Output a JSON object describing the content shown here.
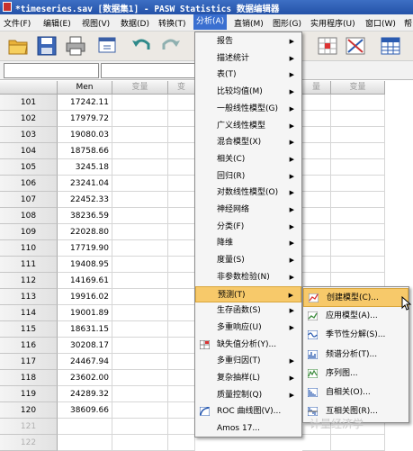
{
  "window": {
    "title": "*timeseries.sav [数据集1] - PASW Statistics 数据编辑器"
  },
  "menubar": [
    "文件(F)",
    "编辑(E)",
    "视图(V)",
    "数据(D)",
    "转换(T)",
    "分析(A)",
    "直销(M)",
    "图形(G)",
    "实用程序(U)",
    "窗口(W)",
    "帮"
  ],
  "grid": {
    "columns": [
      "Men",
      "变量",
      "变",
      "量",
      "变量"
    ],
    "rows": [
      {
        "num": "101",
        "men": "17242.11"
      },
      {
        "num": "102",
        "men": "17979.72"
      },
      {
        "num": "103",
        "men": "19080.03"
      },
      {
        "num": "104",
        "men": "18758.66"
      },
      {
        "num": "105",
        "men": "3245.18"
      },
      {
        "num": "106",
        "men": "23241.04"
      },
      {
        "num": "107",
        "men": "22452.33"
      },
      {
        "num": "108",
        "men": "38236.59"
      },
      {
        "num": "109",
        "men": "22028.80"
      },
      {
        "num": "110",
        "men": "17719.90"
      },
      {
        "num": "111",
        "men": "19408.95"
      },
      {
        "num": "112",
        "men": "14169.61"
      },
      {
        "num": "113",
        "men": "19916.02"
      },
      {
        "num": "114",
        "men": "19001.89"
      },
      {
        "num": "115",
        "men": "18631.15"
      },
      {
        "num": "116",
        "men": "30208.17"
      },
      {
        "num": "117",
        "men": "24467.94"
      },
      {
        "num": "118",
        "men": "23602.00"
      },
      {
        "num": "119",
        "men": "24289.32"
      },
      {
        "num": "120",
        "men": "38609.66"
      },
      {
        "num": "121",
        "men": ""
      },
      {
        "num": "122",
        "men": ""
      }
    ]
  },
  "analyze_menu": [
    {
      "label": "报告",
      "arrow": true
    },
    {
      "label": "描述统计",
      "arrow": true
    },
    {
      "label": "表(T)",
      "arrow": true
    },
    {
      "label": "比较均值(M)",
      "arrow": true
    },
    {
      "label": "一般线性模型(G)",
      "arrow": true
    },
    {
      "label": "广义线性模型",
      "arrow": true
    },
    {
      "label": "混合模型(X)",
      "arrow": true
    },
    {
      "label": "相关(C)",
      "arrow": true
    },
    {
      "label": "回归(R)",
      "arrow": true
    },
    {
      "label": "对数线性模型(O)",
      "arrow": true
    },
    {
      "label": "神经网络",
      "arrow": true
    },
    {
      "label": "分类(F)",
      "arrow": true
    },
    {
      "label": "降维",
      "arrow": true
    },
    {
      "label": "度量(S)",
      "arrow": true
    },
    {
      "label": "非参数检验(N)",
      "arrow": true
    },
    {
      "label": "预测(T)",
      "arrow": true,
      "highlighted": true
    },
    {
      "label": "生存函数(S)",
      "arrow": true
    },
    {
      "label": "多重响应(U)",
      "arrow": true
    },
    {
      "label": "缺失值分析(Y)...",
      "arrow": false,
      "icon": "missing-values-icon"
    },
    {
      "label": "多重归因(T)",
      "arrow": true
    },
    {
      "label": "复杂抽样(L)",
      "arrow": true
    },
    {
      "label": "质量控制(Q)",
      "arrow": true
    },
    {
      "label": "ROC 曲线图(V)...",
      "arrow": false,
      "icon": "roc-curve-icon"
    },
    {
      "label": "Amos 17...",
      "arrow": false
    }
  ],
  "forecast_submenu": [
    {
      "label": "创建模型(C)...",
      "icon": "create-model-icon",
      "highlighted": true
    },
    {
      "label": "应用模型(A)...",
      "icon": "apply-model-icon"
    },
    {
      "label": "季节性分解(S)...",
      "icon": "seasonal-decomposition-icon"
    },
    {
      "label": "频谱分析(T)...",
      "icon": "spectral-analysis-icon"
    },
    {
      "label": "序列图...",
      "icon": "sequence-chart-icon"
    },
    {
      "label": "自相关(O)...",
      "icon": "autocorrelation-icon"
    },
    {
      "label": "互相关图(R)...",
      "icon": "cross-correlation-icon"
    }
  ],
  "watermark": "计量经济学",
  "colors": {
    "title_bar": "#2f5fb8",
    "menu_active": "#3a6fd0",
    "menu_highlight": "#f7c96a"
  }
}
